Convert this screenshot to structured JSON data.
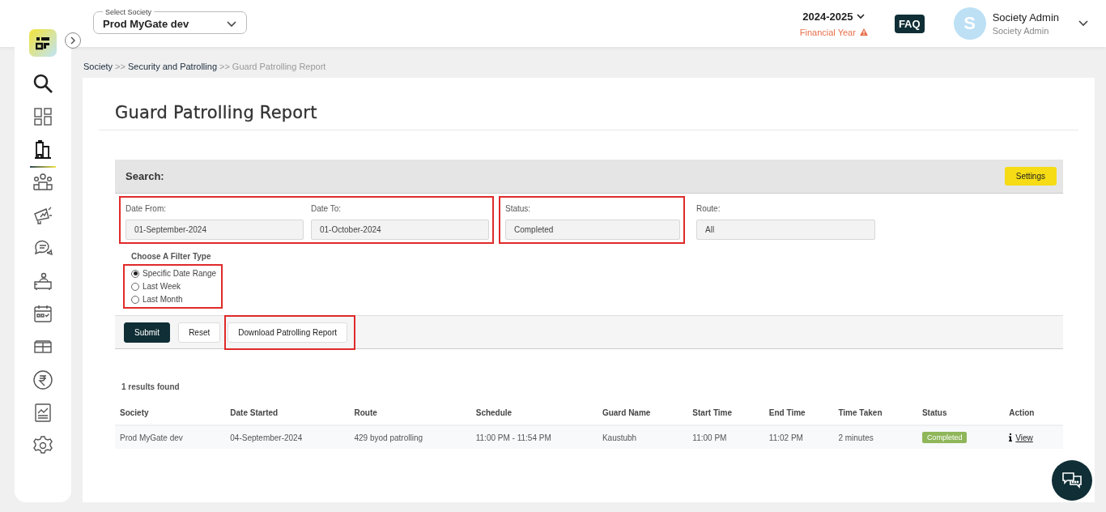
{
  "topbar": {
    "society_select": {
      "label": "Select Society",
      "value": "Prod MyGate dev"
    },
    "year": {
      "value": "2024-2025",
      "caption": "Financial Year"
    },
    "faq": "FAQ",
    "user": {
      "initial": "S",
      "name": "Society Admin",
      "role": "Society Admin"
    }
  },
  "sidebar": {
    "items": [
      {
        "selected": false
      },
      {
        "selected": true
      },
      {
        "selected": false
      },
      {
        "selected": false
      },
      {
        "selected": false
      },
      {
        "selected": false
      },
      {
        "selected": false
      },
      {
        "selected": false
      },
      {
        "selected": false
      },
      {
        "selected": false
      },
      {
        "selected": false
      }
    ]
  },
  "breadcrumb": [
    {
      "label": "Society",
      "current": false
    },
    {
      "label": "Security and Patrolling",
      "current": false
    },
    {
      "label": "Guard Patrolling Report",
      "current": true
    }
  ],
  "separator": ">>",
  "page_title": "Guard Patrolling Report",
  "search": {
    "title": "Search:",
    "settings": "Settings",
    "field_groups": [
      {
        "highlighted": true,
        "fields": [
          {
            "label": "Date From:",
            "value": "01-September-2024"
          },
          {
            "label": "Date To:",
            "value": "01-October-2024"
          }
        ]
      },
      {
        "highlighted": true,
        "fields": [
          {
            "label": "Status:",
            "value": "Completed"
          }
        ]
      },
      {
        "highlighted": false,
        "fields": [
          {
            "label": "Route:",
            "value": "All"
          }
        ]
      }
    ],
    "filter_type": {
      "label": "Choose A Filter Type",
      "highlighted": true,
      "options": [
        {
          "label": "Specific Date Range",
          "selected": true
        },
        {
          "label": "Last Week",
          "selected": false
        },
        {
          "label": "Last Month",
          "selected": false
        }
      ]
    },
    "buttons": [
      {
        "label": "Submit",
        "kind": "primary",
        "highlighted": false
      },
      {
        "label": "Reset",
        "kind": "plain",
        "highlighted": false
      },
      {
        "label": "Download Patrolling Report",
        "kind": "plain",
        "highlighted": true
      }
    ]
  },
  "results": {
    "count": "1 results found",
    "columns": [
      "Society",
      "Date Started",
      "Route",
      "Schedule",
      "Guard Name",
      "Start Time",
      "End Time",
      "Time Taken",
      "Status",
      "Action"
    ],
    "rows": [
      {
        "society": "Prod MyGate dev",
        "date_started": "04-September-2024",
        "route": "429 byod patrolling",
        "schedule": "11:00 PM - 11:54 PM",
        "guard_name": "Kaustubh",
        "start_time": "11:00 PM",
        "end_time": "11:02 PM",
        "time_taken": "2 minutes",
        "status": "Completed",
        "action": "View"
      }
    ]
  }
}
